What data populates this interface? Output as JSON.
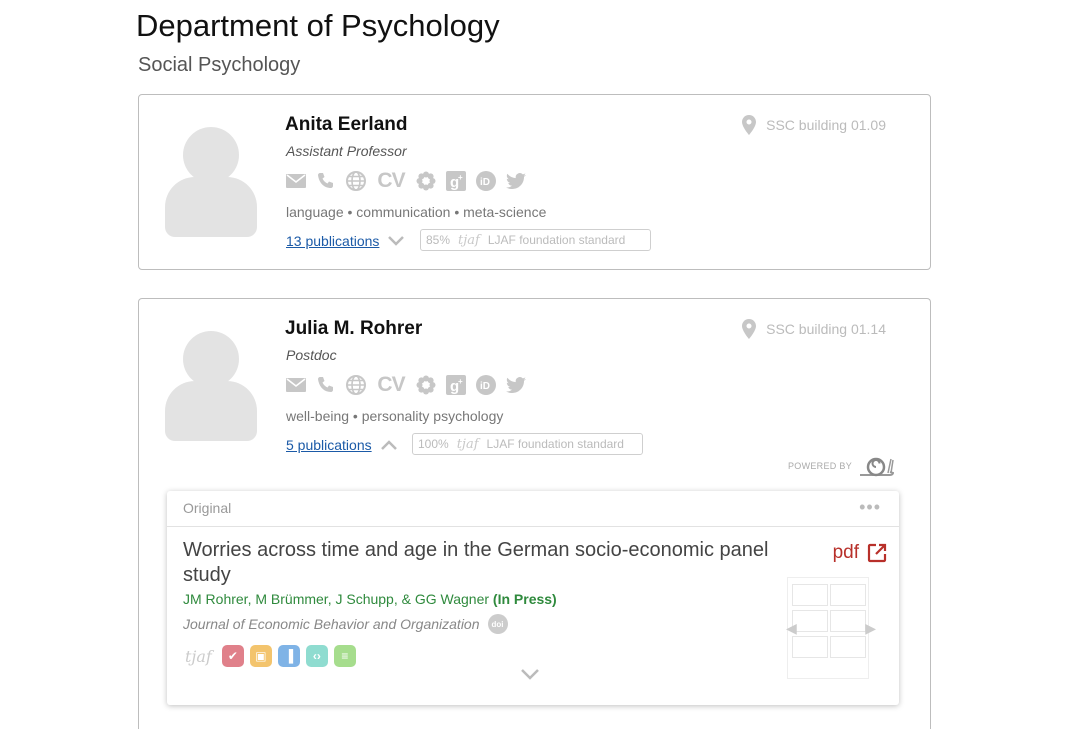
{
  "page": {
    "title": "Department of Psychology",
    "subtitle": "Social Psychology"
  },
  "icons": [
    "mail-icon",
    "phone-icon",
    "globe-icon",
    "cv-icon",
    "orcid-flower-icon",
    "google-scholar-icon",
    "orcid-id-icon",
    "twitter-icon"
  ],
  "cv_label": "CV",
  "people": [
    {
      "name": "Anita Eerland",
      "role": "Assistant Professor",
      "location": "SSC building 01.09",
      "tags": "language • communication • meta-science",
      "publications_link": "13 publications",
      "ljaf_percent": "85%",
      "ljaf_label": "LJAF foundation standard",
      "expanded": false
    },
    {
      "name": "Julia M. Rohrer",
      "role": "Postdoc",
      "location": "SSC building 01.14",
      "tags": "well-being • personality psychology",
      "publications_link": "5 publications",
      "ljaf_percent": "100%",
      "ljaf_label": "LJAF foundation standard",
      "expanded": true
    }
  ],
  "tjaf_logo": "tjaf",
  "powered_by": "POWERED BY",
  "publication": {
    "kind": "Original",
    "menu": "•••",
    "title": "Worries across time and age in the German socio-economic panel study",
    "authors": "JM Rohrer, M Brümmer, J Schupp, & GG Wagner",
    "status": "(In Press)",
    "journal": "Journal of Economic Behavior and Organization",
    "doi_label": "doi",
    "pdf_label": "pdf",
    "badges": [
      {
        "name": "check-badge",
        "color": "#e0808a",
        "glyph": "✔"
      },
      {
        "name": "box-badge",
        "color": "#f3c46d",
        "glyph": "▣"
      },
      {
        "name": "chart-badge",
        "color": "#7fb3e6",
        "glyph": "▐"
      },
      {
        "name": "code-badge",
        "color": "#8fdcd0",
        "glyph": "‹›"
      },
      {
        "name": "document-badge",
        "color": "#a6dd8d",
        "glyph": "≡"
      }
    ]
  },
  "colors": {
    "link": "#1b5aa7",
    "authors": "#2f8a3d",
    "pdf": "#b8302a"
  }
}
